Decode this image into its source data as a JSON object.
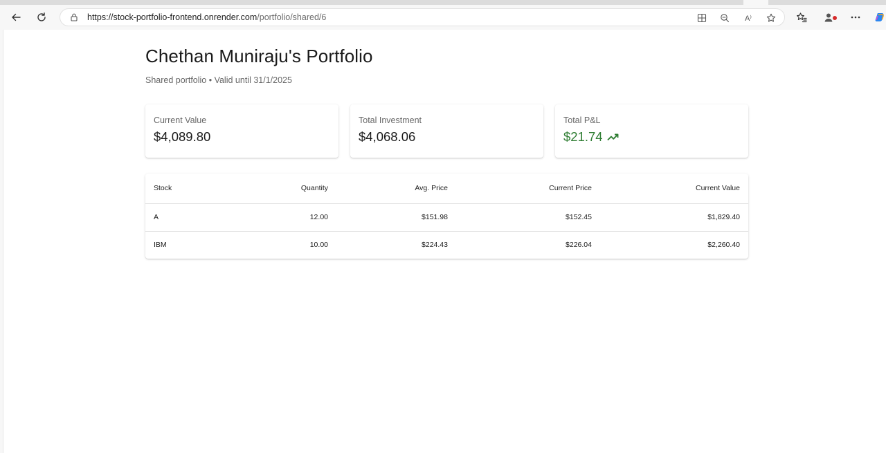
{
  "browser": {
    "url_host": "https://stock-portfolio-frontend.onrender.com",
    "url_path": "/portfolio/shared/6",
    "read_aloud_glyph": "A⁾",
    "icons": {
      "back": "back-arrow-icon",
      "refresh": "refresh-icon",
      "lock": "lock-icon",
      "apps": "app-available-icon",
      "zoom": "zoom-out-icon",
      "read_aloud": "read-aloud-icon",
      "favorite": "star-icon",
      "favorites": "favorites-icon",
      "profile": "profile-icon",
      "menu": "more-icon",
      "copilot": "copilot-icon"
    }
  },
  "page": {
    "title": "Chethan Muniraju's Portfolio",
    "subtitle": "Shared portfolio • Valid until 31/1/2025"
  },
  "summary": {
    "current_value": {
      "label": "Current Value",
      "value": "$4,089.80"
    },
    "total_investment": {
      "label": "Total Investment",
      "value": "$4,068.06"
    },
    "total_pnl": {
      "label": "Total P&L",
      "value": "$21.74",
      "color": "#2e7d32",
      "icon": "trending-up-icon"
    }
  },
  "holdings": {
    "headers": {
      "stock": "Stock",
      "quantity": "Quantity",
      "avg_price": "Avg. Price",
      "current_price": "Current Price",
      "current_value": "Current Value"
    },
    "rows": [
      {
        "stock": "A",
        "quantity": "12.00",
        "avg_price": "$151.98",
        "current_price": "$152.45",
        "current_value": "$1,829.40"
      },
      {
        "stock": "IBM",
        "quantity": "10.00",
        "avg_price": "$224.43",
        "current_price": "$226.04",
        "current_value": "$2,260.40"
      }
    ]
  }
}
